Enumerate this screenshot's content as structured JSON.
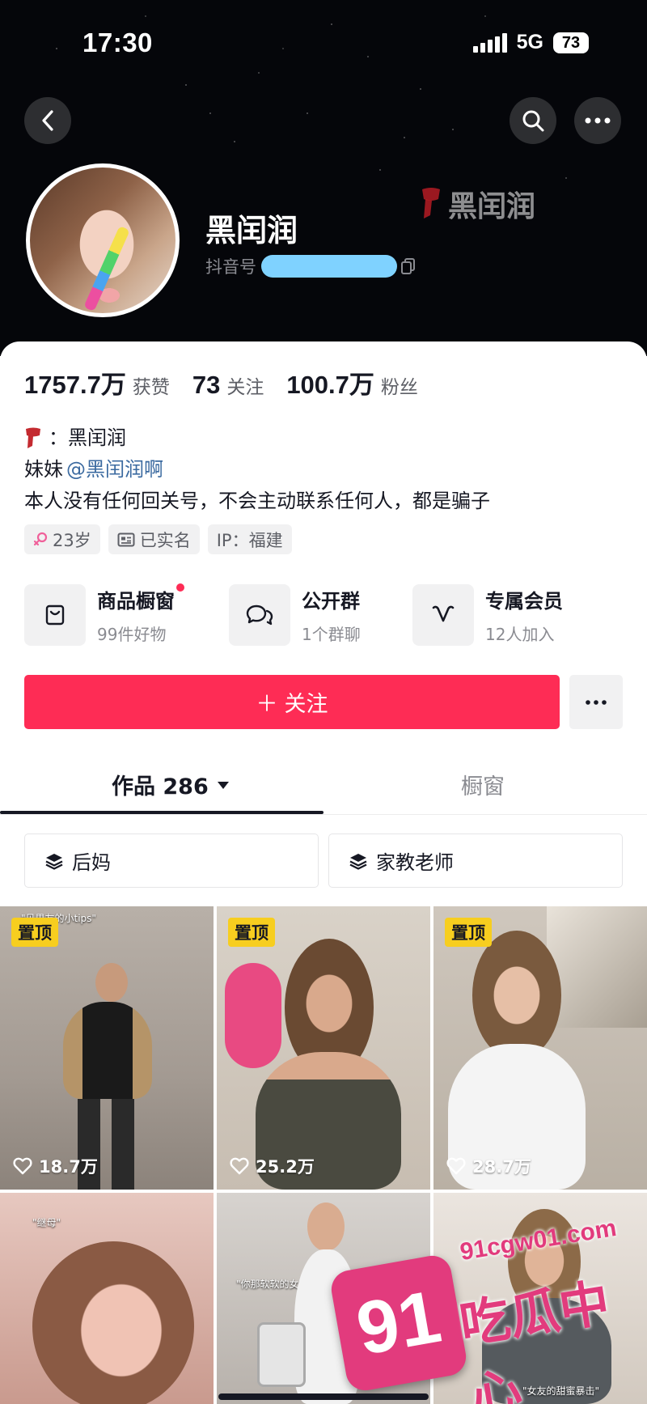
{
  "status_bar": {
    "time": "17:30",
    "network": "5G",
    "battery": "73"
  },
  "profile": {
    "name": "黑闰润",
    "id_label": "抖音号",
    "watermark_name": "黑闰润"
  },
  "stats": [
    {
      "value": "1757.7万",
      "label": "获赞"
    },
    {
      "value": "73",
      "label": "关注"
    },
    {
      "value": "100.7万",
      "label": "粉丝"
    }
  ],
  "bio": {
    "line1": "：黑闰润",
    "line2_prefix": "妹妹",
    "line2_mention": "@黑闰润啊",
    "line3": "本人没有任何回关号，不会主动联系任何人，都是骗子"
  },
  "tags": [
    {
      "icon": "female-icon",
      "label": "23岁"
    },
    {
      "icon": "id-card-icon",
      "label": "已实名"
    },
    {
      "icon": "",
      "label": "IP：福建"
    }
  ],
  "features": [
    {
      "icon": "shopping-bag-icon",
      "title": "商品橱窗",
      "sub": "99件好物",
      "dot": true
    },
    {
      "icon": "chat-group-icon",
      "title": "公开群",
      "sub": "1个群聊",
      "dot": false
    },
    {
      "icon": "vip-v-icon",
      "title": "专属会员",
      "sub": "12人加入",
      "dot": false
    }
  ],
  "follow_button": {
    "label": "关注",
    "prefix": "＋"
  },
  "tabs": [
    {
      "label": "作品 286",
      "active": true
    },
    {
      "label": "橱窗",
      "active": false
    }
  ],
  "collections": [
    {
      "label": "后妈"
    },
    {
      "label": "家教老师"
    }
  ],
  "videos": [
    {
      "pinned": true,
      "pin_label": "置顶",
      "likes": "18.7万",
      "caption": "\"见男友的小tips\""
    },
    {
      "pinned": true,
      "pin_label": "置顶",
      "likes": "25.2万",
      "caption": ""
    },
    {
      "pinned": true,
      "pin_label": "置顶",
      "likes": "28.7万",
      "caption": ""
    },
    {
      "pinned": false,
      "pin_label": "",
      "likes": "",
      "caption": "\"继母\""
    },
    {
      "pinned": false,
      "pin_label": "",
      "likes": "",
      "caption": "\"你那软软的女友\""
    },
    {
      "pinned": false,
      "pin_label": "",
      "likes": "",
      "caption": "\"女友的甜蜜暴击\""
    }
  ],
  "watermark": {
    "number": "91",
    "site": "91cgw01.com",
    "text": "吃瓜中心"
  },
  "colors": {
    "accent": "#fe2c55",
    "pin": "#f7ce1f",
    "mention": "#3b6aa0",
    "watermark": "#e23b7d"
  }
}
